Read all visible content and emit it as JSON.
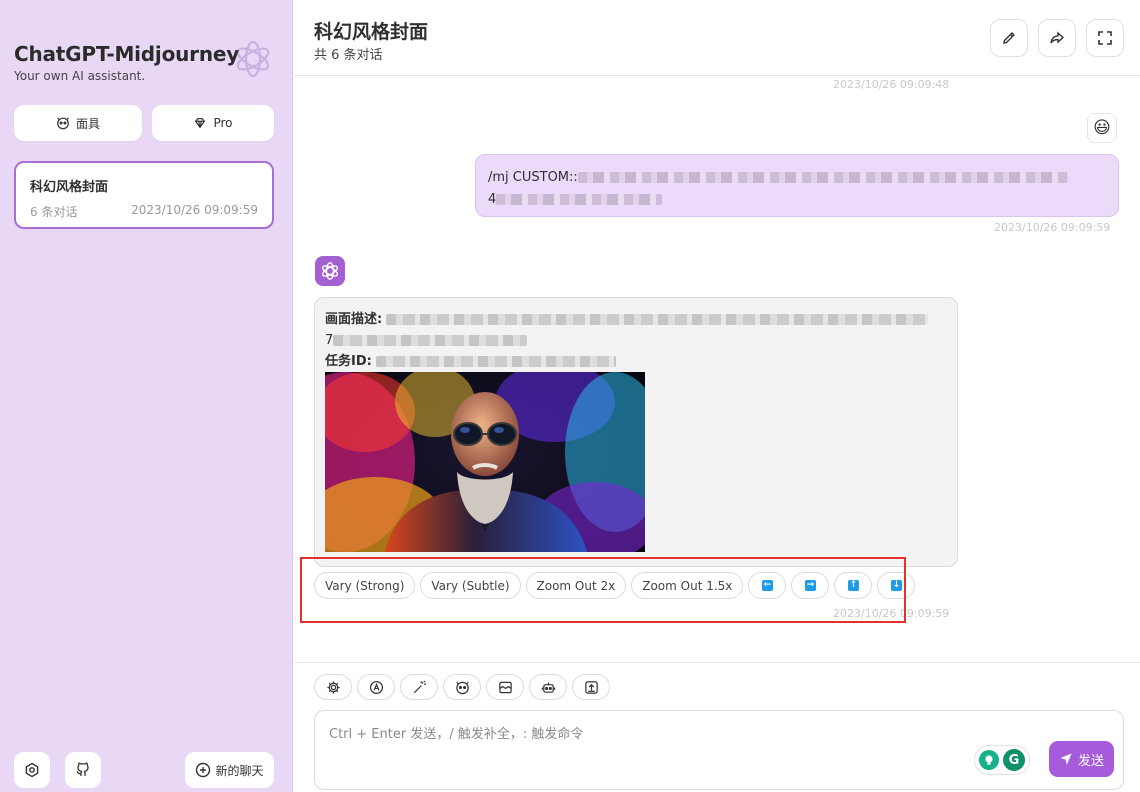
{
  "sidebar": {
    "title": "ChatGPT-Midjourney",
    "subtitle": "Your own AI assistant.",
    "mask_button": "面具",
    "pro_button": "Pro",
    "chats": [
      {
        "title": "科幻风格封面",
        "count": "6 条对话",
        "date": "2023/10/26 09:09:59"
      }
    ],
    "new_chat": "新的聊天"
  },
  "header": {
    "title": "科幻风格封面",
    "subtitle": "共 6 条对话"
  },
  "messages": {
    "ts_top": "2023/10/26 09:09:48",
    "user_emoji": "😃",
    "user_prefix": "/mj CUSTOM::",
    "user_line2_prefix": "4",
    "ts_user": "2023/10/26 09:09:59",
    "bot_desc_label": "画面描述:",
    "bot_desc_prefix": "7",
    "bot_task_label": "任务ID:",
    "ts_bot": "2023/10/26 09:09:59",
    "actions": [
      "Vary (Strong)",
      "Vary (Subtle)",
      "Zoom Out 2x",
      "Zoom Out 1.5x"
    ],
    "arrows": [
      "←",
      "→",
      "↑",
      "↓"
    ]
  },
  "input": {
    "placeholder": "Ctrl + Enter 发送，/ 触发补全，: 触发命令",
    "send_label": "发送"
  },
  "colors": {
    "sidebar_bg": "#e8d8f6",
    "accent": "#a65bdb",
    "user_bubble": "#ecdafa",
    "highlight": "#e2332b"
  }
}
